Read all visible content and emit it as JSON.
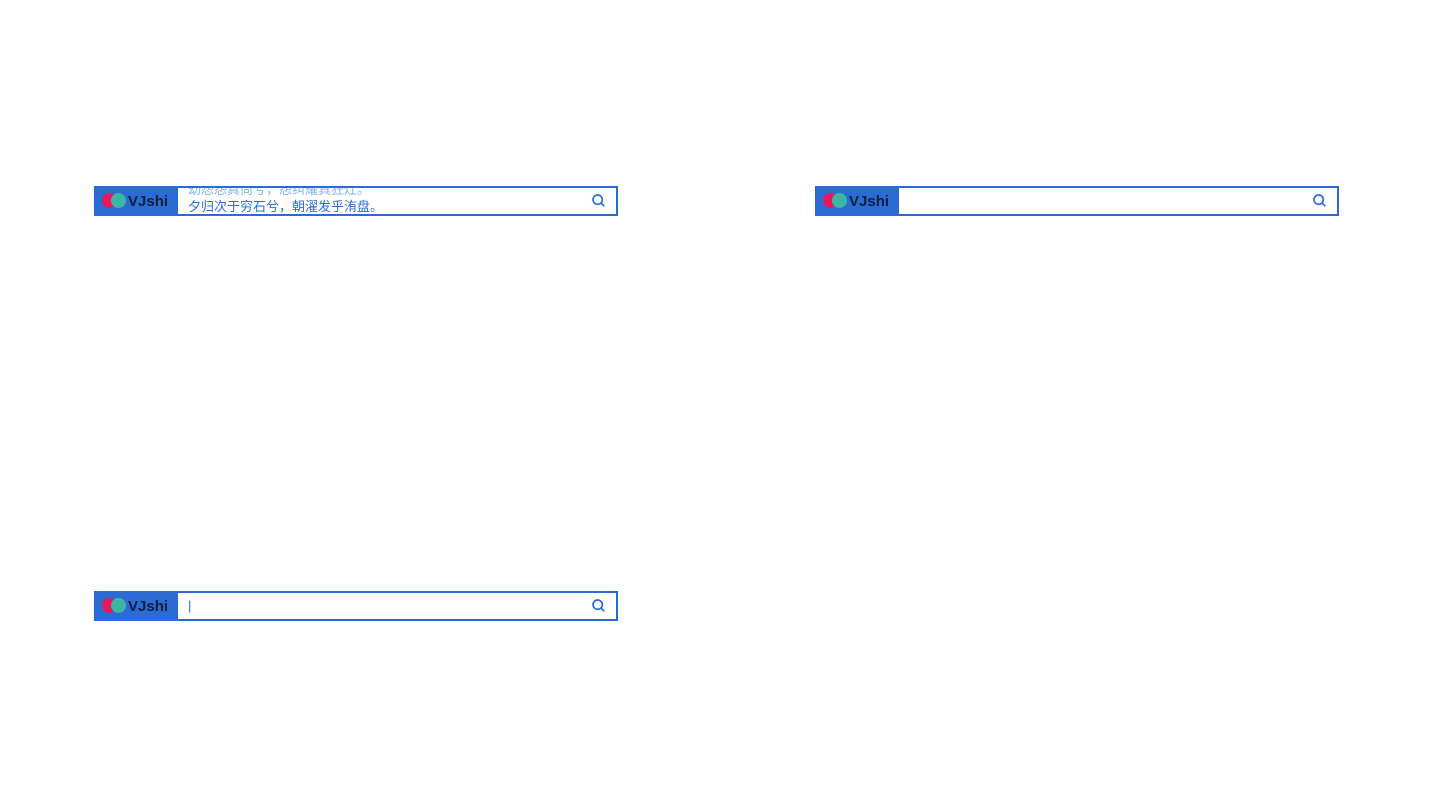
{
  "logo": {
    "text": "VJshi",
    "circle1_color": "#e6195a",
    "circle2_color": "#3bb8a5"
  },
  "colors": {
    "primary": "#2b6cd4",
    "background": "#ffffff"
  },
  "widgets": [
    {
      "id": "widget-1",
      "lines": [
        "幼怨怨真尚兮，怨纠耀具狂灶。",
        "夕归次于穷石兮，朝濯发乎洧盘。"
      ],
      "cursor": "",
      "mode": "scrolling"
    },
    {
      "id": "widget-2",
      "lines": [],
      "cursor": "",
      "mode": "empty"
    },
    {
      "id": "widget-3",
      "lines": [],
      "cursor": "|",
      "mode": "cursor"
    }
  ]
}
